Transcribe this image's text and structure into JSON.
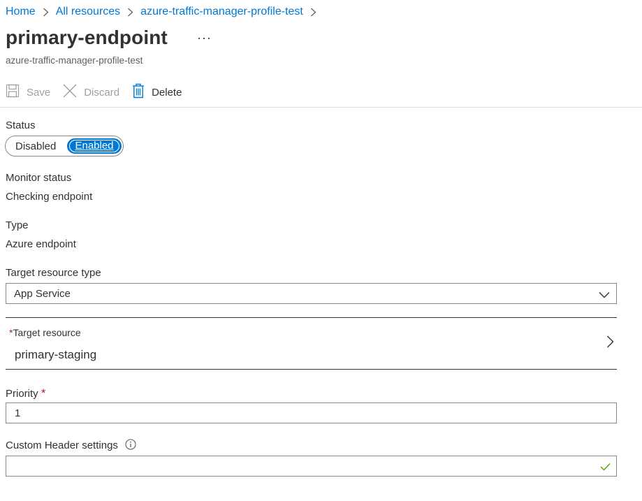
{
  "breadcrumb": {
    "items": [
      "Home",
      "All resources",
      "azure-traffic-manager-profile-test"
    ]
  },
  "header": {
    "title": "primary-endpoint",
    "more_label": "···",
    "subtitle": "azure-traffic-manager-profile-test"
  },
  "toolbar": {
    "save_label": "Save",
    "discard_label": "Discard",
    "delete_label": "Delete"
  },
  "status": {
    "label": "Status",
    "options": [
      "Disabled",
      "Enabled"
    ],
    "selected": "Enabled"
  },
  "monitor": {
    "label": "Monitor status",
    "value": "Checking endpoint"
  },
  "type": {
    "label": "Type",
    "value": "Azure endpoint"
  },
  "target_resource_type": {
    "label": "Target resource type",
    "value": "App Service"
  },
  "target_resource": {
    "required_mark": "*",
    "label": "Target resource",
    "value": "primary-staging"
  },
  "priority": {
    "label": "Priority",
    "required_mark": "*",
    "value": "1"
  },
  "custom_header": {
    "label": "Custom Header settings",
    "value": ""
  },
  "icons": {
    "save": "save-icon",
    "discard": "discard-icon",
    "delete": "trash-icon",
    "info": "info-icon",
    "validation": "checkmark-icon"
  },
  "colors": {
    "accent": "#0078d4",
    "required": "#a4262c",
    "valid": "#57a300"
  }
}
